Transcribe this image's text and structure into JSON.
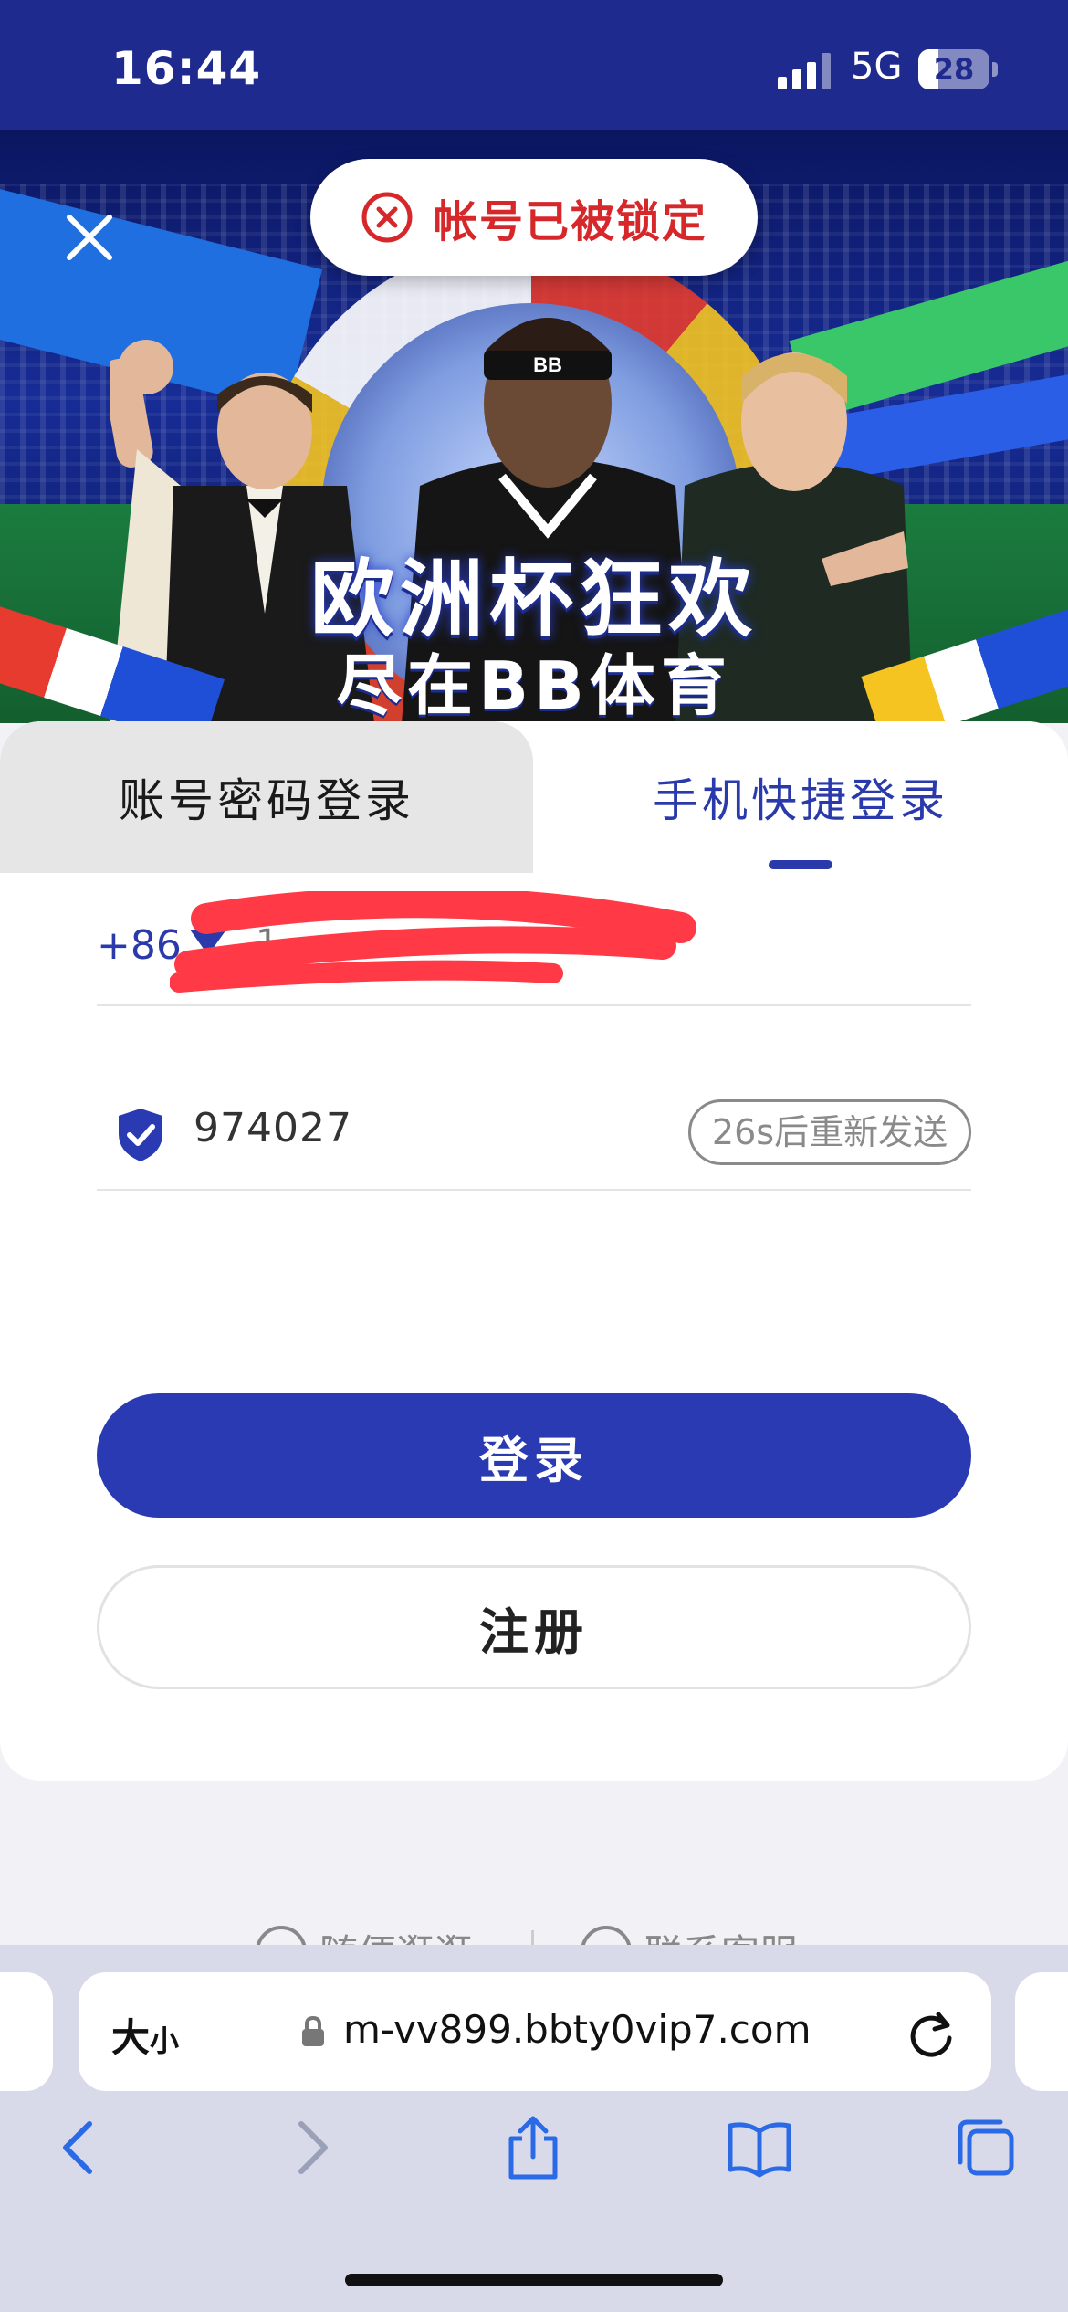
{
  "status_bar": {
    "time": "16:44",
    "network": "5G",
    "battery": "28",
    "battery_level_percent": 28
  },
  "banner": {
    "title": "欧洲杯狂欢",
    "subtitle": "尽在BB体育",
    "headband_text": "BB",
    "close_icon": "close-icon"
  },
  "toast": {
    "icon": "error-circle-icon",
    "message": "帐号已被锁定",
    "color": "#d6282b"
  },
  "login": {
    "tabs": [
      {
        "label": "账号密码登录",
        "active": false
      },
      {
        "label": "手机快捷登录",
        "active": true
      }
    ],
    "phone": {
      "country_code": "+86",
      "value_partial": "1",
      "redacted": true
    },
    "code": {
      "value": "974027",
      "resend_label": "26s后重新发送"
    },
    "login_button": "登录",
    "register_button": "注册",
    "accent_color": "#2a3ab3"
  },
  "bottom_links": [
    {
      "label": "随便逛逛",
      "icon": "soccer-ball-icon"
    },
    {
      "label": "联系客服",
      "icon": "headset-icon"
    }
  ],
  "browser": {
    "text_size_label_big": "大",
    "text_size_label_small": "小",
    "url": "m-vv899.bbty0vip7.com",
    "toolbar_icons": [
      "back-icon",
      "forward-icon",
      "share-icon",
      "bookmarks-icon",
      "tabs-icon"
    ]
  }
}
